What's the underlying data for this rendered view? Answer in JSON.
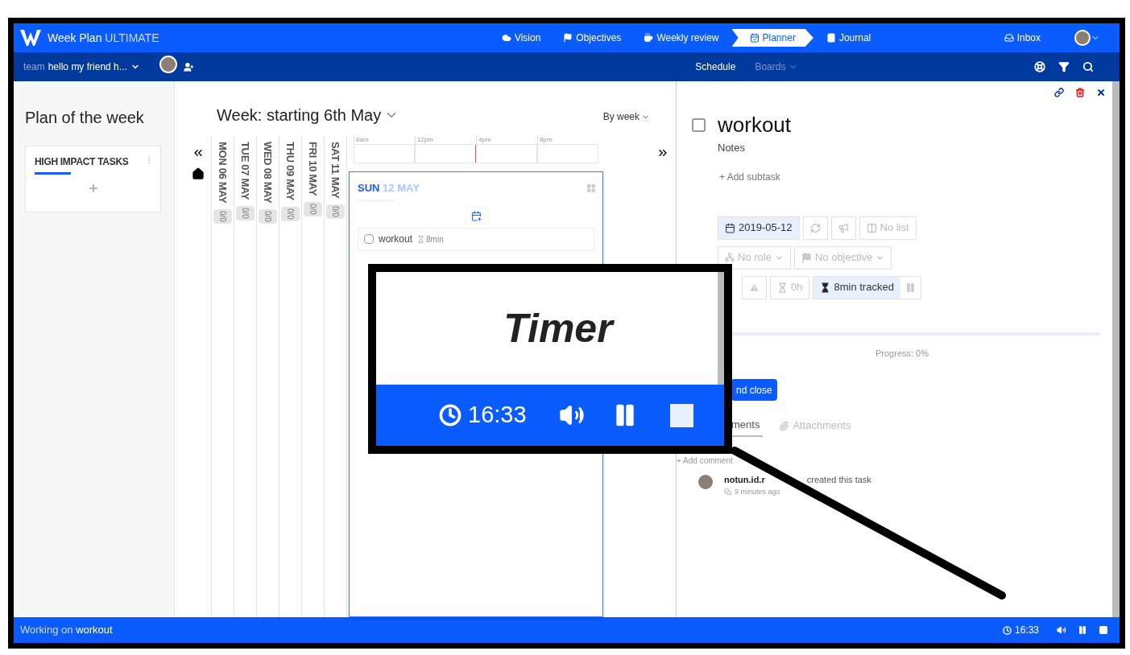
{
  "app": {
    "brand": "Week Plan",
    "edition": "ULTIMATE"
  },
  "nav": [
    {
      "label": "Vision",
      "selected": false
    },
    {
      "label": "Objectives",
      "selected": false
    },
    {
      "label": "Weekly review",
      "selected": false
    },
    {
      "label": "Planner",
      "selected": true
    },
    {
      "label": "Journal",
      "selected": false
    }
  ],
  "inbox": "Inbox",
  "team": {
    "label": "team",
    "name": "hello my friend h..."
  },
  "subnav": [
    {
      "label": "Schedule",
      "selected": true
    },
    {
      "label": "Boards",
      "selected": false
    }
  ],
  "sidebar": {
    "title": "Plan of the week",
    "card_title": "HIGH IMPACT TASKS"
  },
  "week": {
    "title": "Week: starting 6th May",
    "view": "By week",
    "days": [
      {
        "label": "MON 06 MAY",
        "count": "0/0"
      },
      {
        "label": "TUE 07 MAY",
        "count": "0/0"
      },
      {
        "label": "WED 08 MAY",
        "count": "0/0"
      },
      {
        "label": "THU 09 MAY",
        "count": "0/0"
      },
      {
        "label": "FRI 10 MAY",
        "count": "0/0"
      },
      {
        "label": "SAT 11 MAY",
        "count": "0/0"
      }
    ],
    "timeline": [
      "8am",
      "12pm",
      "4pm",
      "8pm"
    ],
    "today": {
      "weekday": "SUN",
      "date": "12 MAY",
      "tasks": [
        {
          "name": "workout",
          "duration": "8min",
          "checked": false
        }
      ]
    }
  },
  "task": {
    "title": "workout",
    "checked": false,
    "notes": "Notes",
    "add_subtask": "+ Add subtask",
    "date": "2019-05-12",
    "list": "No list",
    "role": "No role",
    "objective": "No objective",
    "estimate": "0h",
    "tracked": "8min tracked",
    "progress": {
      "level": 0,
      "label": "Progress: 0%"
    },
    "save_button": "nd close",
    "tabs": [
      {
        "label": "ments",
        "selected": true
      },
      {
        "label": "Attachments",
        "selected": false
      }
    ],
    "add_comment": "+ Add comment",
    "activity": {
      "user": "notun.id.r",
      "action": "created this task",
      "time": "9 minutes ago"
    }
  },
  "status_bar": {
    "label": "Working on",
    "task": "workout",
    "time": "16:33"
  },
  "callout": {
    "title": "Timer",
    "time": "16:33"
  }
}
